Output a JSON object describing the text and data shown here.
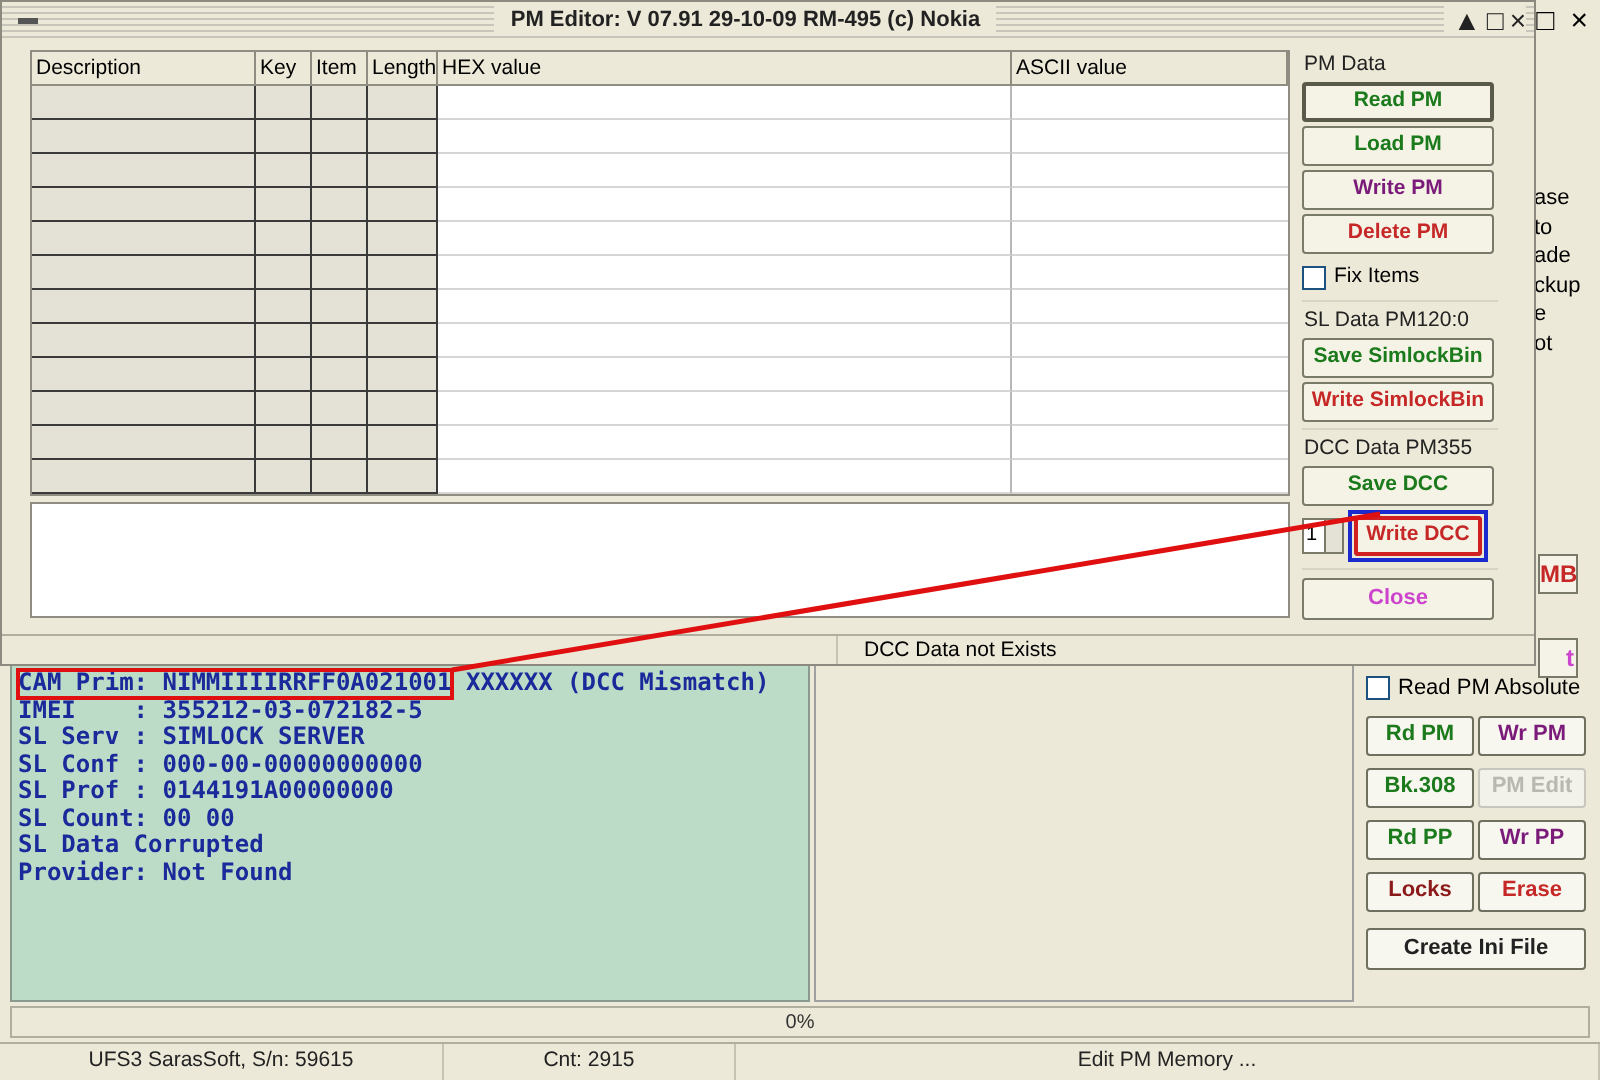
{
  "main_window": {
    "title_buttons": [
      "□",
      "×"
    ],
    "background_fragments": [
      "ase",
      "to",
      "ade",
      "ckup",
      "e",
      "ot"
    ],
    "partial_buttons": [
      {
        "label": "MB",
        "color": "#c62828"
      },
      {
        "label": "t",
        "color": "#cc44cc"
      }
    ],
    "log": {
      "lines": [
        {
          "parts": [
            {
              "text": "CAM Prim: NIMMIIIIRRFF0A021001",
              "boxed": true
            },
            {
              "text": " XXXXXX (DCC Mismatch)",
              "boxed": false
            }
          ]
        },
        {
          "parts": [
            {
              "text": "IMEI    : 355212-03-072182-5",
              "boxed": false
            }
          ]
        },
        {
          "parts": [
            {
              "text": "SL Serv : SIMLOCK SERVER",
              "boxed": false
            }
          ]
        },
        {
          "parts": [
            {
              "text": "SL Conf : 000-00-00000000000",
              "boxed": false
            }
          ]
        },
        {
          "parts": [
            {
              "text": "SL Prof : 0144191A00000000",
              "boxed": false
            }
          ]
        },
        {
          "parts": [
            {
              "text": "SL Count: 00 00",
              "boxed": false
            }
          ]
        },
        {
          "parts": [
            {
              "text": "SL Data Corrupted",
              "boxed": false
            }
          ]
        },
        {
          "parts": [
            {
              "text": "Provider: Not Found",
              "boxed": false
            }
          ]
        }
      ]
    },
    "right_panel": {
      "checkbox": {
        "label": "Read PM Absolute",
        "checked": false
      },
      "buttons": [
        {
          "label": "Rd PM",
          "color": "#1b7a1b",
          "disabled": false
        },
        {
          "label": "Wr PM",
          "color": "#7a1b7a",
          "disabled": false
        },
        {
          "label": "Bk.308",
          "color": "#1b7a1b",
          "disabled": false
        },
        {
          "label": "PM Edit",
          "color": "#b8b8b0",
          "disabled": true
        },
        {
          "label": "Rd PP",
          "color": "#1b7a1b",
          "disabled": false
        },
        {
          "label": "Wr PP",
          "color": "#7a1b7a",
          "disabled": false
        },
        {
          "label": "Locks",
          "color": "#8b1a1a",
          "disabled": false
        },
        {
          "label": "Erase",
          "color": "#c62828",
          "disabled": false
        }
      ],
      "create_button": "Create Ini File"
    },
    "progress": {
      "level": 0,
      "label": "0%"
    },
    "status_bar": [
      "UFS3 SarasSoft, S/n: 59615",
      "Cnt: 2915",
      "Edit PM Memory ..."
    ]
  },
  "dialog": {
    "title": "PM Editor: V 07.91 29-10-09 RM-495 (c) Nokia",
    "title_buttons": [
      "▲",
      "□",
      "×"
    ],
    "table": {
      "columns": [
        "Description",
        "Key",
        "Item",
        "Length",
        "HEX value",
        "ASCII value"
      ]
    },
    "groups": [
      {
        "label": "PM Data",
        "items": [
          {
            "kind": "button",
            "label": "Read PM",
            "color": "#1b7a1b",
            "focused": true,
            "highlighted": false
          },
          {
            "kind": "button",
            "label": "Load PM",
            "color": "#1b7a1b",
            "focused": false,
            "highlighted": false
          },
          {
            "kind": "button",
            "label": "Write PM",
            "color": "#7a1b7a",
            "focused": false,
            "highlighted": false
          },
          {
            "kind": "button",
            "label": "Delete PM",
            "color": "#c62828",
            "focused": false,
            "highlighted": false
          },
          {
            "kind": "checkbox",
            "label": "Fix Items",
            "checked": false
          }
        ]
      },
      {
        "label": "SL Data PM120:0",
        "items": [
          {
            "kind": "button",
            "label": "Save SimlockBin",
            "color": "#1b7a1b",
            "focused": false,
            "highlighted": false
          },
          {
            "kind": "button",
            "label": "Write SimlockBin",
            "color": "#c62828",
            "focused": false,
            "highlighted": false
          }
        ]
      },
      {
        "label": "DCC Data PM355",
        "items": [
          {
            "kind": "button",
            "label": "Save DCC",
            "color": "#1b7a1b",
            "focused": false,
            "highlighted": false
          },
          {
            "kind": "spinner-button",
            "value": "1",
            "label": "Write DCC",
            "color": "#c62828",
            "focused": false,
            "highlighted": true
          }
        ]
      }
    ],
    "close_button": {
      "label": "Close",
      "color": "#cc44cc"
    },
    "status": "DCC Data not Exists"
  }
}
